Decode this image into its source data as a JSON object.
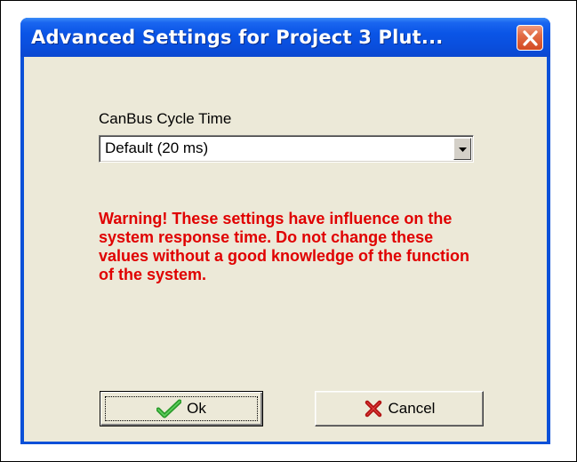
{
  "window": {
    "title": "Advanced Settings for Project 3 Plut..."
  },
  "icons": {
    "close": "close-icon",
    "dropdown": "chevron-down-icon",
    "ok": "checkmark-icon",
    "cancel": "cross-icon"
  },
  "colors": {
    "title_bar": "#0a55e6",
    "close_button": "#e26b45",
    "client_bg": "#ece9d8",
    "warning_text": "#e00000",
    "ok_check": "#2a9a2a",
    "cancel_cross": "#b01010"
  },
  "form": {
    "cycle_time_label": "CanBus Cycle Time",
    "cycle_time_value": "Default (20 ms)"
  },
  "warning": {
    "text": "Warning! These settings have influence on the system response time. Do not change these values without a good knowledge of the function of the system."
  },
  "buttons": {
    "ok_label": "Ok",
    "cancel_label": "Cancel"
  }
}
